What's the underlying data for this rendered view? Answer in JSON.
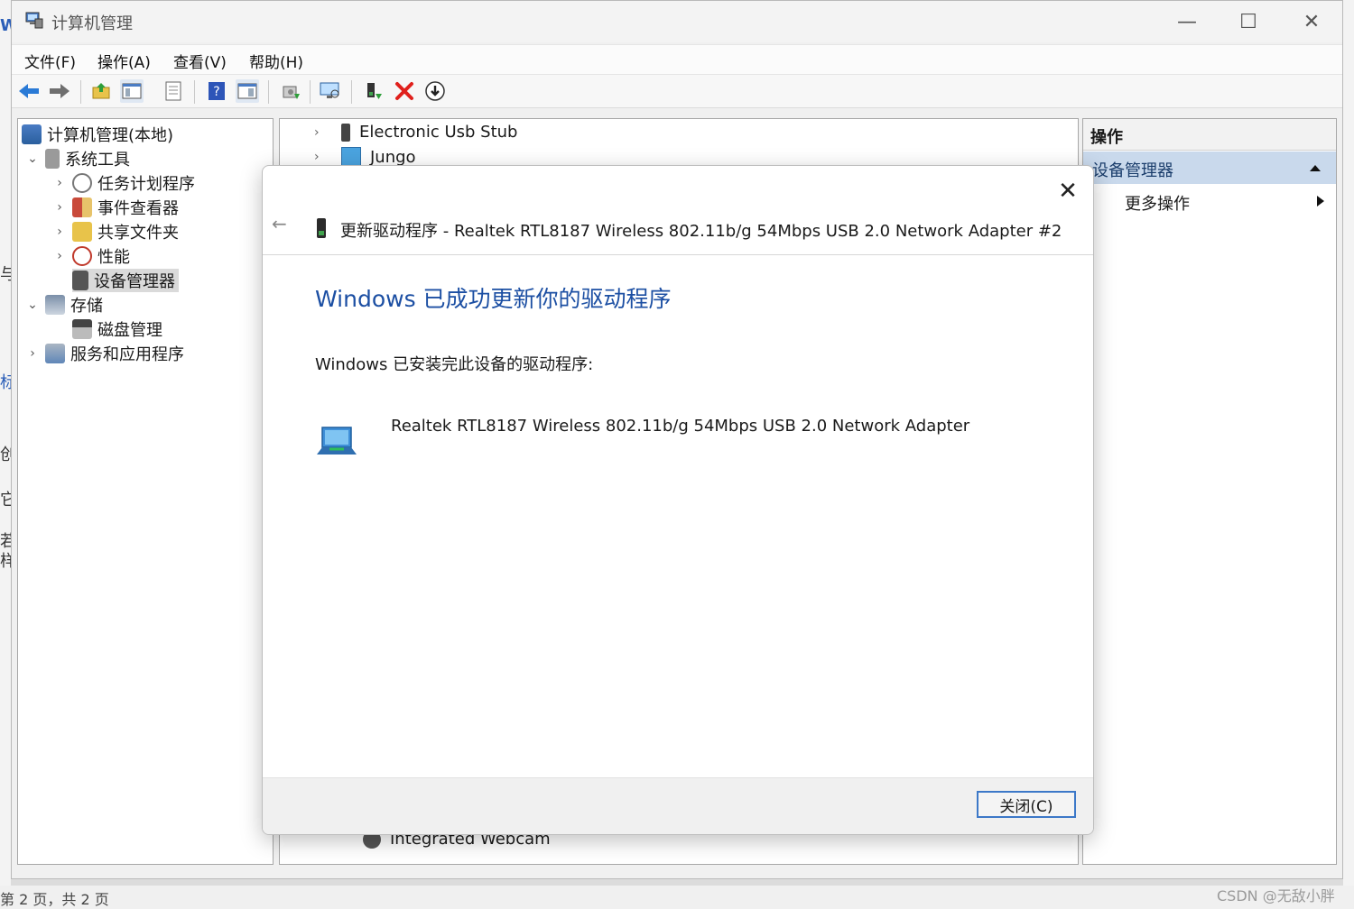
{
  "window": {
    "title": "计算机管理",
    "minimize": "—",
    "maximize": "☐",
    "close": "✕"
  },
  "menu": [
    "文件(F)",
    "操作(A)",
    "查看(V)",
    "帮助(H)"
  ],
  "toolbar_icons": [
    "back-icon",
    "forward-icon",
    "up-folder-icon",
    "show-tree-icon",
    "properties-icon",
    "help-icon",
    "toggle-pane-icon",
    "update-driver-icon",
    "scan-hardware-icon",
    "enable-device-icon",
    "uninstall-icon",
    "download-icon"
  ],
  "tree": {
    "root": "计算机管理(本地)",
    "system_tools": "系统工具",
    "task_scheduler": "任务计划程序",
    "event_viewer": "事件查看器",
    "shared_folders": "共享文件夹",
    "performance": "性能",
    "device_manager": "设备管理器",
    "storage": "存储",
    "disk_management": "磁盘管理",
    "services_apps": "服务和应用程序"
  },
  "devices": {
    "row1": "Electronic Usb Stub",
    "row2": "Jungo",
    "row_bottom": "Integrated Webcam"
  },
  "actions": {
    "header": "操作",
    "section": "设备管理器",
    "more": "更多操作"
  },
  "dialog": {
    "title": "更新驱动程序 - Realtek RTL8187 Wireless 802.11b/g 54Mbps USB 2.0 Network Adapter #2",
    "heading": "Windows 已成功更新你的驱动程序",
    "message": "Windows 已安装完此设备的驱动程序:",
    "adapter_name": "Realtek RTL8187 Wireless 802.11b/g 54Mbps USB 2.0 Network Adapter",
    "close_button": "关闭(C)"
  },
  "background": {
    "status_text": "第 2 页，共 2 页",
    "watermark": "CSDN @无敌小胖"
  },
  "colors": {
    "heading_blue": "#1c4fa3",
    "selection_blue": "#c9d9ec",
    "delete_red": "#e0201c"
  }
}
